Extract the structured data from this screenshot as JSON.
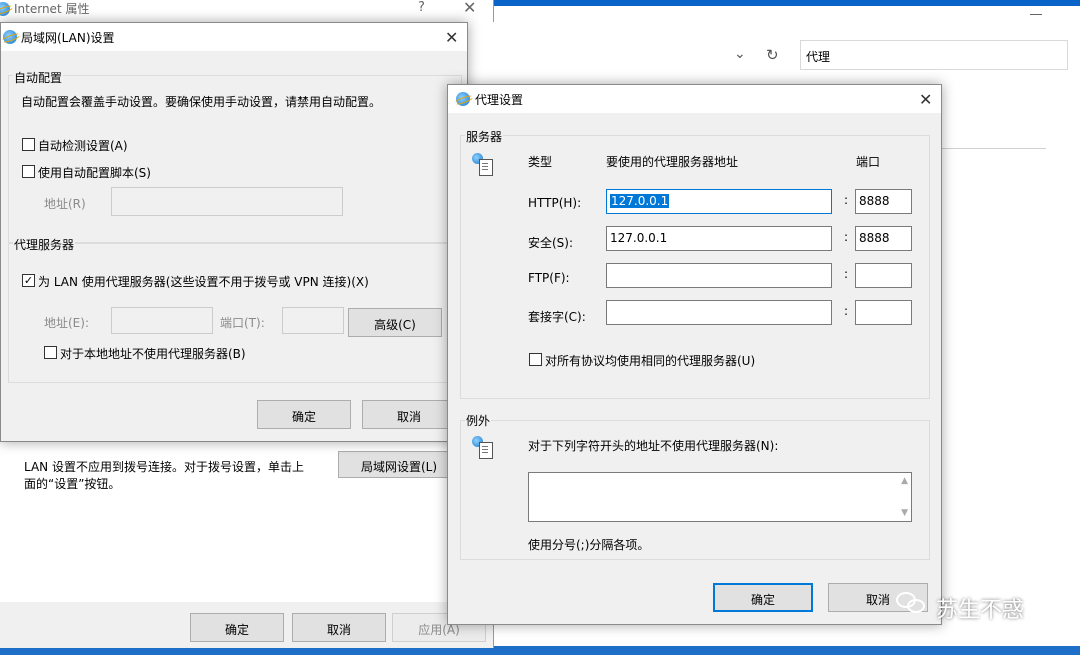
{
  "browser": {
    "address_text": "代理"
  },
  "internet_props": {
    "title": "Internet 属性",
    "help_glyph": "?",
    "lan_text_line1": "LAN 设置不应用到拨号连接。对于拨号设置，单击上",
    "lan_text_line2": "面的“设置”按钮。",
    "lan_button": "局域网设置(L)",
    "ok": "确定",
    "cancel": "取消",
    "apply": "应用(A)"
  },
  "lan_dialog": {
    "title": "局域网(LAN)设置",
    "auto_config_group": "自动配置",
    "auto_config_desc": "自动配置会覆盖手动设置。要确保使用手动设置，请禁用自动配置。",
    "auto_detect": {
      "label": "自动检测设置(A)",
      "checked": false
    },
    "use_script": {
      "label": "使用自动配置脚本(S)",
      "checked": false
    },
    "address_label": "地址(R)",
    "proxy_group": "代理服务器",
    "use_proxy": {
      "label": "为 LAN 使用代理服务器(这些设置不用于拨号或 VPN 连接)(X)",
      "checked": true
    },
    "proxy_address_label": "地址(E):",
    "proxy_port_label": "端口(T):",
    "advanced_button": "高级(C)",
    "bypass_local": {
      "label": "对于本地地址不使用代理服务器(B)",
      "checked": false
    },
    "ok": "确定",
    "cancel": "取消"
  },
  "proxy_dialog": {
    "title": "代理设置",
    "servers_group": "服务器",
    "col_type": "类型",
    "col_address": "要使用的代理服务器地址",
    "col_port": "端口",
    "rows": [
      {
        "label": "HTTP(H):",
        "address": "127.0.0.1",
        "port": "8888"
      },
      {
        "label": "安全(S):",
        "address": "127.0.0.1",
        "port": "8888"
      },
      {
        "label": "FTP(F):",
        "address": "",
        "port": ""
      },
      {
        "label": "套接字(C):",
        "address": "",
        "port": ""
      }
    ],
    "same_proxy": {
      "label": "对所有协议均使用相同的代理服务器(U)",
      "checked": false
    },
    "exceptions_group": "例外",
    "exceptions_label": "对于下列字符开头的地址不使用代理服务器(N):",
    "exceptions_value": "",
    "exceptions_hint": "使用分号(;)分隔各项。",
    "ok": "确定",
    "cancel": "取消"
  },
  "watermark": {
    "text": "苏生不惑"
  }
}
